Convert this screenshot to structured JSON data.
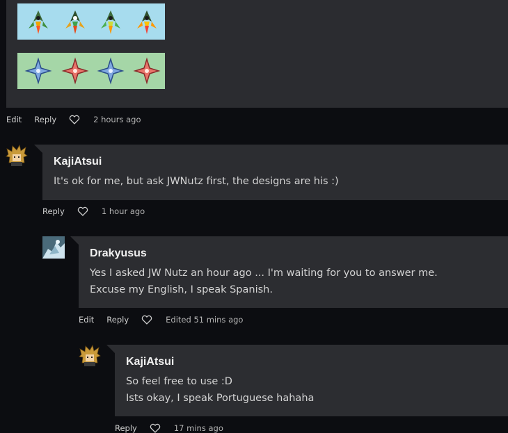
{
  "top_post": {
    "actions": {
      "edit": "Edit",
      "reply": "Reply",
      "time": "2 hours ago"
    }
  },
  "comments": [
    {
      "author": "KajiAtsui",
      "lines": [
        "It's ok for me, but ask JWNutz first, the designs are his :)"
      ],
      "actions": {
        "reply": "Reply",
        "time": "1 hour ago"
      }
    },
    {
      "author": "Drakyusus",
      "lines": [
        "Yes I asked JW Nutz an hour ago ... I'm waiting for you to answer me.",
        "Excuse my English, I speak Spanish."
      ],
      "actions": {
        "edit": "Edit",
        "reply": "Reply",
        "time": "Edited 51 mins ago"
      }
    },
    {
      "author": "KajiAtsui",
      "lines": [
        "So feel free to use :D",
        "Ists okay, I speak Portuguese hahaha"
      ],
      "actions": {
        "reply": "Reply",
        "time": "17 mins ago"
      }
    }
  ],
  "icons": {
    "like": "heart-outline-icon"
  },
  "colors": {
    "page_bg": "#0c0d11",
    "card_bg": "#2c2d31",
    "strip_blue": "#a7dcee",
    "strip_green": "#a5d6a7"
  }
}
